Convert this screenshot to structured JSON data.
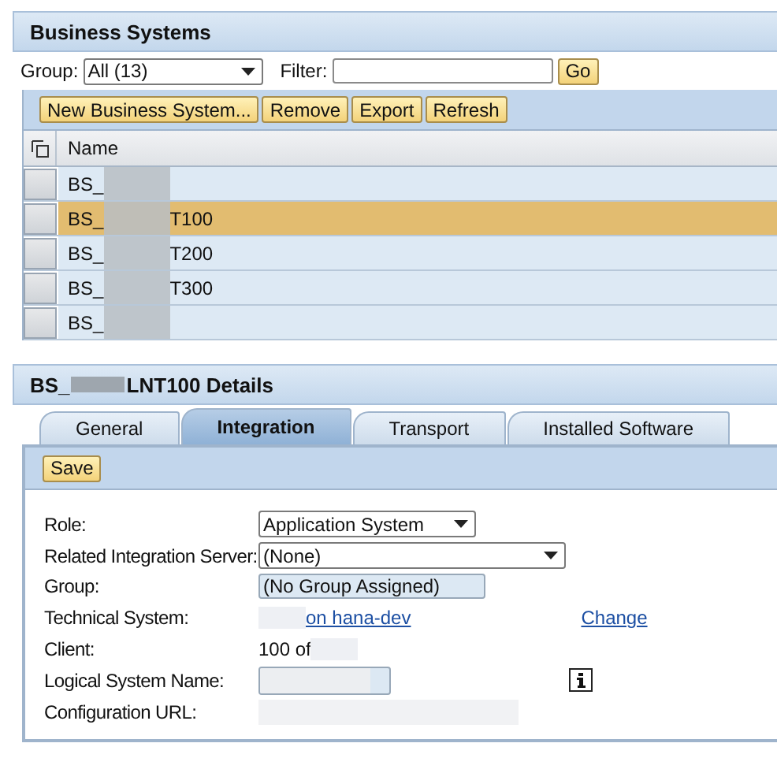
{
  "list_panel": {
    "title": "Business Systems"
  },
  "filter_bar": {
    "group_label": "Group:",
    "group_value": "All (13)",
    "filter_label": "Filter:",
    "go_button": "Go"
  },
  "toolbar": [
    "New Business System...",
    "Remove",
    "Export",
    "Refresh"
  ],
  "table": {
    "columns": [
      "Name"
    ],
    "rows": [
      {
        "prefix": "BS_",
        "selected": false
      },
      {
        "prefix": "BS_",
        "suffix": "T100",
        "selected": true
      },
      {
        "prefix": "BS_",
        "suffix": "T200",
        "selected": false
      },
      {
        "prefix": "BS_",
        "suffix": "T300",
        "selected": false
      },
      {
        "prefix": "BS_",
        "selected": false
      }
    ]
  },
  "details": {
    "title_prefix": "BS_",
    "title_suffix": "LNT100 Details",
    "tabs": [
      {
        "label": "General",
        "selected": false
      },
      {
        "label": "Integration",
        "selected": true
      },
      {
        "label": "Transport",
        "selected": false
      },
      {
        "label": "Installed Software",
        "selected": false
      }
    ],
    "save_button": "Save",
    "fields": [
      {
        "kind": "dropdown",
        "label": "Role:",
        "value": "Application System"
      },
      {
        "kind": "dropdown",
        "label": "Related Integration Server:",
        "value": "(None)"
      },
      {
        "kind": "readonly",
        "label": "Group:",
        "value": "(No Group Assigned)"
      },
      {
        "kind": "link",
        "label": "Technical System:",
        "value": "on hana-dev",
        "action": "Change"
      },
      {
        "kind": "text",
        "label": "Client:",
        "value": "100 of"
      },
      {
        "kind": "input",
        "label": "Logical System Name:"
      },
      {
        "kind": "blank",
        "label": "Configuration URL:"
      }
    ]
  }
}
